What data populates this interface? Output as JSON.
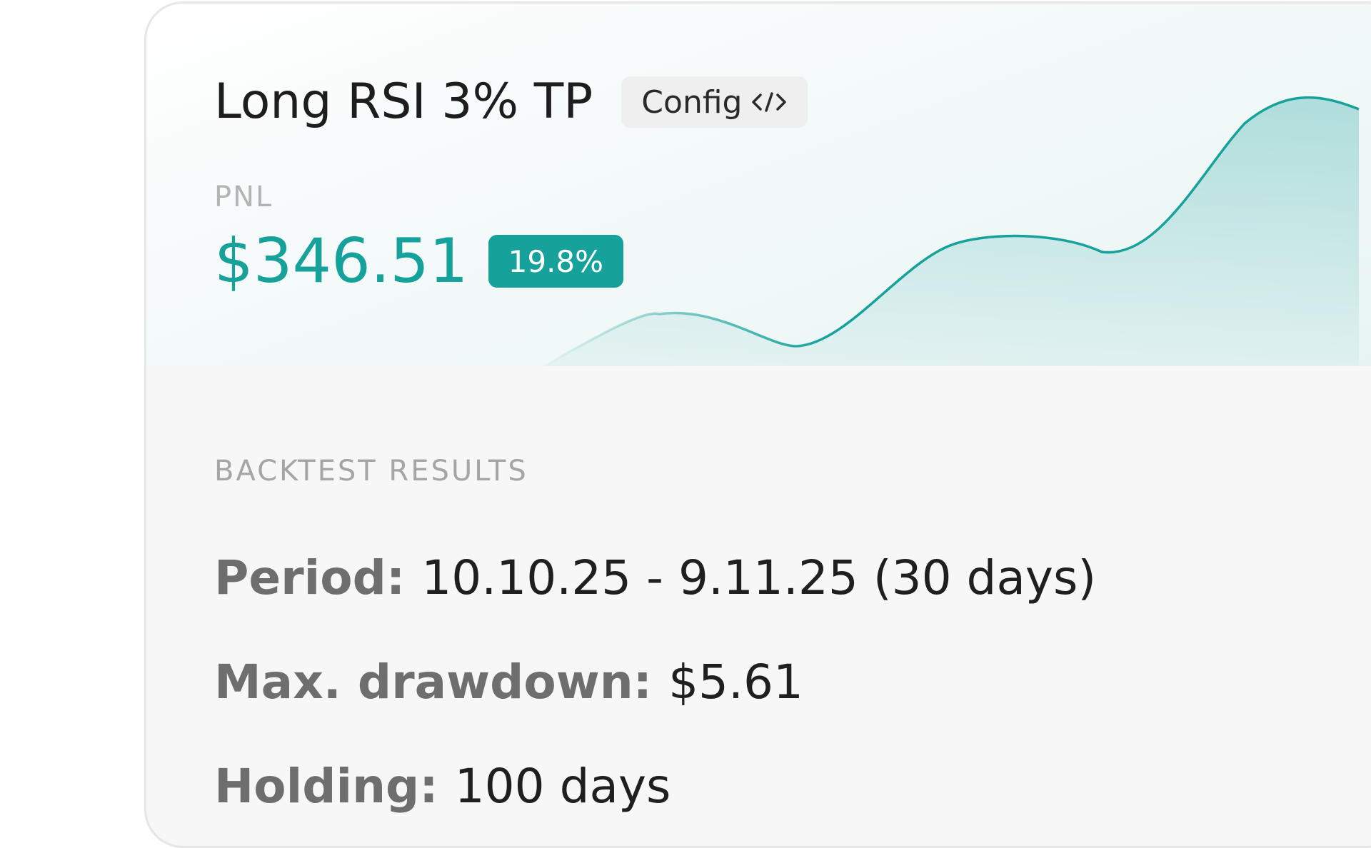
{
  "card": {
    "title": "Long RSI 3% TP",
    "config_label": "Config",
    "config_icon": "code-icon",
    "pnl_label": "PNL",
    "pnl_value": "$346.51",
    "pnl_percent": "19.8%",
    "accent_color": "#16a19a"
  },
  "backtest": {
    "section_label": "BACKTEST RESULTS",
    "period_key": "Period:",
    "period_value": "10.10.25 - 9.11.25 (30 days)",
    "drawdown_key": "Max. drawdown:",
    "drawdown_value": "$5.61",
    "holding_key": "Holding:",
    "holding_value": "100 days"
  }
}
